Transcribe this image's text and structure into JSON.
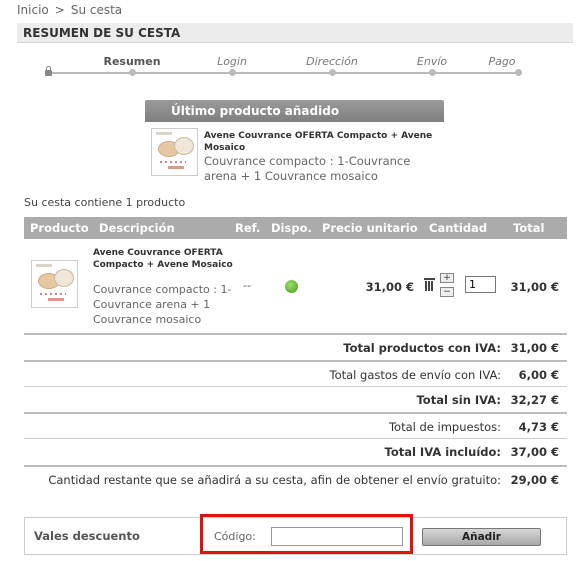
{
  "breadcrumb": {
    "home": "Inicio",
    "separator": ">",
    "current": "Su cesta"
  },
  "page_title": "RESUMEN DE SU CESTA",
  "steps": [
    {
      "label": "Resumen",
      "active": true
    },
    {
      "label": "Login",
      "active": false
    },
    {
      "label": "Dirección",
      "active": false
    },
    {
      "label": "Envío",
      "active": false
    },
    {
      "label": "Pago",
      "active": false
    }
  ],
  "last_added": {
    "heading": "Último producto añadido",
    "name": "Avene Couvrance OFERTA Compacto + Avene Mosaico",
    "description": "Couvrance compacto : 1-Couvrance arena + 1 Couvrance mosaico"
  },
  "cart_count_text": "Su cesta contiene 1 producto",
  "table_headers": {
    "product": "Producto",
    "description": "Descripción",
    "ref": "Ref.",
    "availability": "Dispo.",
    "unit_price": "Precio unitario",
    "quantity": "Cantidad",
    "total": "Total"
  },
  "cart_item": {
    "name": "Avene Couvrance OFERTA Compacto + Avene Mosaico",
    "description": "Couvrance compacto : 1-Couvrance arena + 1 Couvrance mosaico",
    "ref": "--",
    "unit_price": "31,00 €",
    "quantity": "1",
    "plus": "+",
    "minus": "−",
    "total": "31,00 €",
    "availability_color": "#4caf2a"
  },
  "totals": [
    {
      "label": "Total productos con IVA:",
      "value": "31,00 €",
      "bold": true
    },
    {
      "label": "Total gastos de envío con IVA:",
      "value": "6,00 €",
      "bold": false
    },
    {
      "label": "Total sin IVA:",
      "value": "32,27 €",
      "bold": true
    },
    {
      "label": "Total de impuestos:",
      "value": "4,73 €",
      "bold": false
    },
    {
      "label": "Total IVA incluído:",
      "value": "37,00 €",
      "bold": true
    },
    {
      "label": "Cantidad restante que se añadirá a su cesta, afin de obtener el envío gratuito:",
      "value": "29,00 €",
      "bold": false
    }
  ],
  "voucher": {
    "label": "Vales descuento",
    "code_label": "Código:",
    "code_value": "",
    "button": "Añadir",
    "highlight_color": "#e01111"
  }
}
